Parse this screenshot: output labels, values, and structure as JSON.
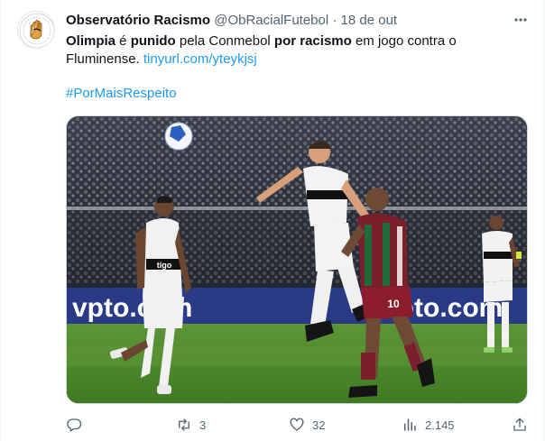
{
  "tweet": {
    "author_name": "Observatório Racismo",
    "handle": "@ObRacialFutebol",
    "separator": "·",
    "date": "18 de out",
    "text": {
      "part1_bold": "Olimpia",
      "part2": " é ",
      "part3_bold": "punido",
      "part4": " pela Conmebol ",
      "part5_bold": "por racismo",
      "part6": " em jogo contra o Fluminense. ",
      "link": "tinyurl.com/yteykjsj"
    },
    "hashtag": "#PorMaisRespeito"
  },
  "media": {
    "board_left": "vpto.com",
    "board_right": "vpto.com",
    "jersey_sponsor": "tigo",
    "jersey_number": "10"
  },
  "actions": {
    "replies": "",
    "retweets": "3",
    "likes": "32",
    "views": "2.145"
  },
  "colors": {
    "accent": "#1d9bf0",
    "muted": "#536471",
    "olimpia_black": "#111111",
    "fluminense_maroon": "#7a1f2b",
    "fluminense_green": "#1f6b3a",
    "pitch": "#4f8a2c"
  }
}
